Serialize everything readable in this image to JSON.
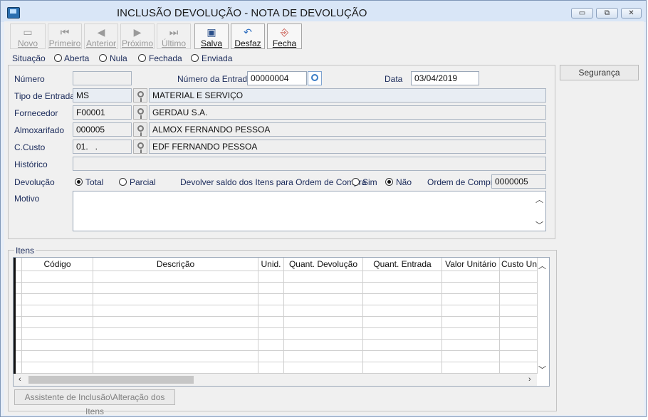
{
  "window": {
    "title": "INCLUSÃO DEVOLUÇÃO - NOTA DE DEVOLUÇÃO",
    "minimize": "▭",
    "restore": "⧉",
    "close": "✕"
  },
  "toolbar": {
    "novo": "Novo",
    "primeiro": "Primeiro",
    "anterior": "Anterior",
    "proximo": "Próximo",
    "ultimo": "Último",
    "salva": "Salva",
    "desfaz": "Desfaz",
    "fecha": "Fecha"
  },
  "situacao": {
    "label": "Situação",
    "options": [
      "Aberta",
      "Nula",
      "Fechada",
      "Enviada"
    ]
  },
  "seguranca_button": "Segurança",
  "form": {
    "numero_label": "Número",
    "numero_value": "",
    "numero_entrada_label": "Número da Entrada",
    "numero_entrada_value": "00000004",
    "data_label": "Data",
    "data_value": "03/04/2019",
    "tipo_entrada_label": "Tipo de Entrada",
    "tipo_entrada_code": "MS",
    "tipo_entrada_desc": "MATERIAL E SERVIÇO",
    "fornecedor_label": "Fornecedor",
    "fornecedor_code": "F00001",
    "fornecedor_desc": "GERDAU S.A.",
    "almoxarifado_label": "Almoxarifado",
    "almoxarifado_code": "000005",
    "almoxarifado_desc": "ALMOX FERNANDO PESSOA",
    "ccusto_label": "C.Custo",
    "ccusto_code": "01.   .",
    "ccusto_desc": "EDF FERNANDO PESSOA",
    "historico_label": "Histórico",
    "historico_value": "",
    "devolucao_label": "Devolução",
    "devolucao_total": "Total",
    "devolucao_parcial": "Parcial",
    "devolver_saldo_label": "Devolver saldo dos Itens para Ordem de Compra",
    "sim": "Sim",
    "nao": "Não",
    "ordem_compra_label": "Ordem de Compra",
    "ordem_compra_value": "0000005",
    "motivo_label": "Motivo",
    "motivo_value": ""
  },
  "itens": {
    "label": "Itens",
    "columns": [
      "Código",
      "Descrição",
      "Unid.",
      "Quant. Devolução",
      "Quant. Entrada",
      "Valor Unitário",
      "Custo Unitá"
    ],
    "assistente_button": "Assistente de Inclusão\\Alteração dos Itens"
  },
  "colors": {
    "window_frame": "#7f97b8",
    "titlebar": "#d9e6f7",
    "label_text": "#1a2a5a"
  }
}
